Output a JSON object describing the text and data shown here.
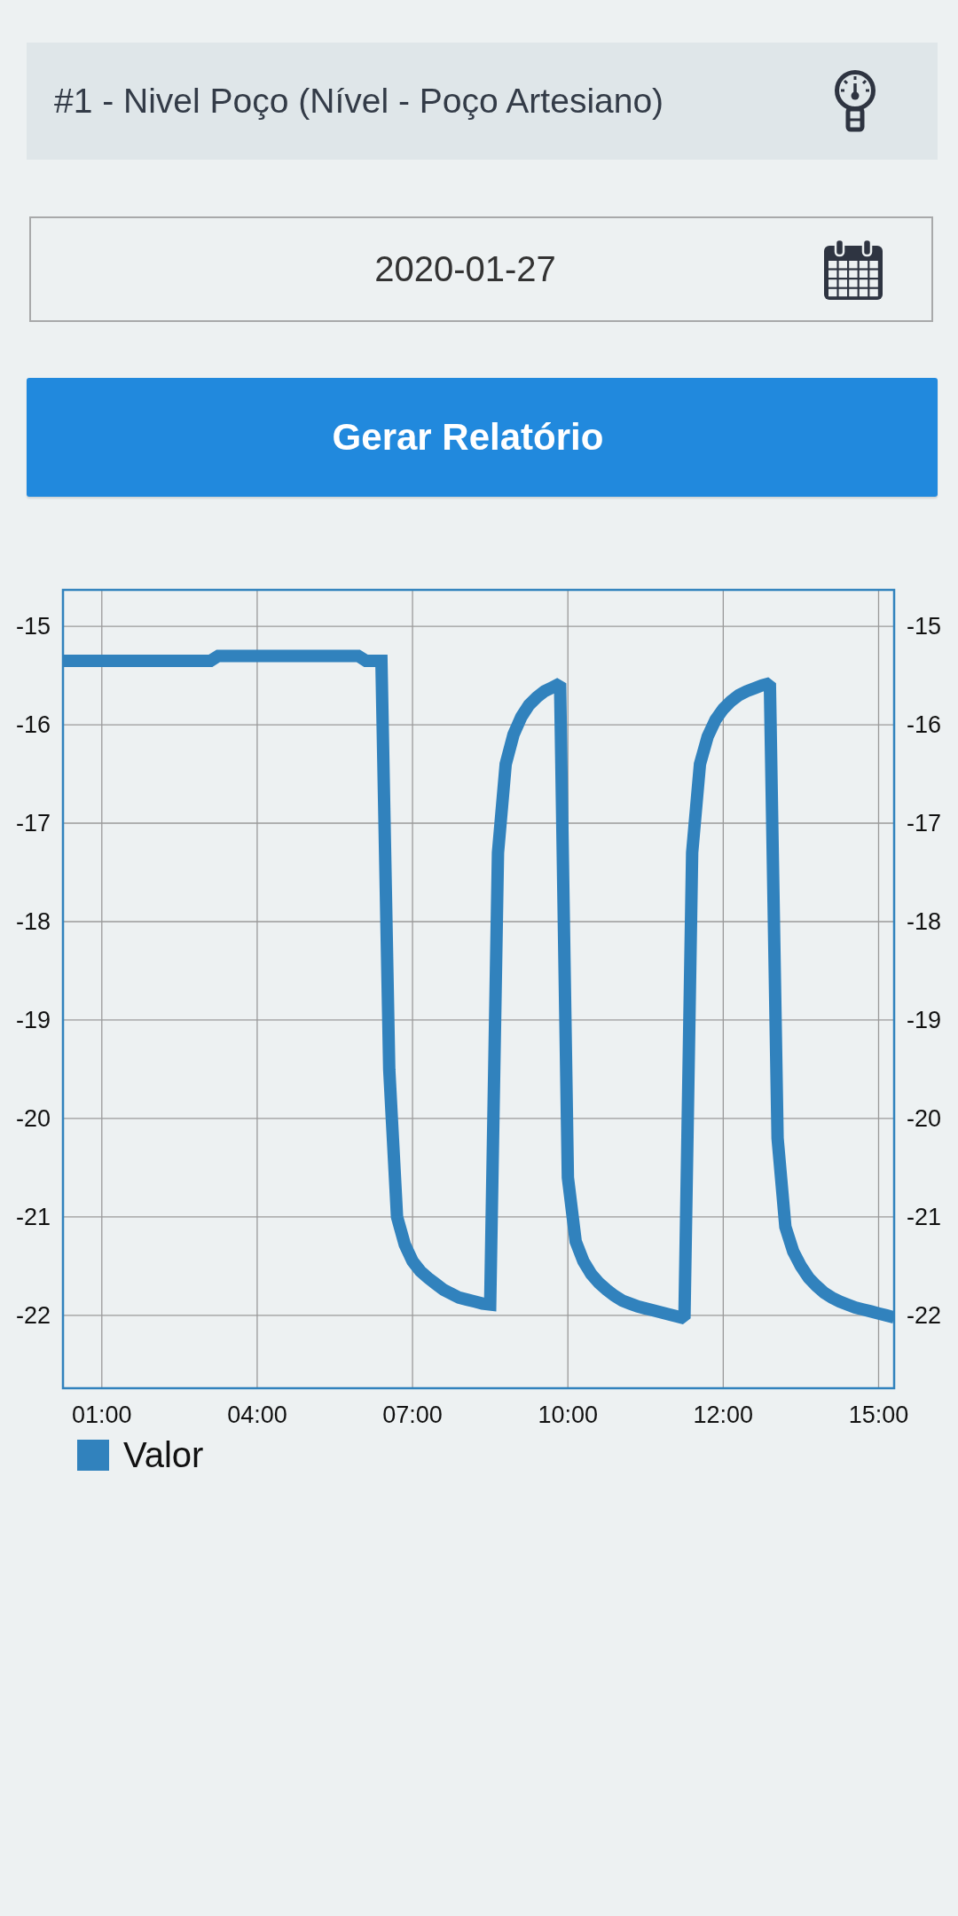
{
  "selector": {
    "label": "#1 - Nivel Poço (Nível - Poço Artesiano)"
  },
  "date_field": {
    "value": "2020-01-27"
  },
  "button": {
    "label": "Gerar Relatório"
  },
  "chart": {
    "chart_data": {
      "type": "line",
      "grid": true,
      "categories": [
        null,
        null,
        null,
        null,
        null,
        "01:00",
        null,
        null,
        null,
        null,
        null,
        null,
        null,
        null,
        null,
        null,
        null,
        null,
        null,
        null,
        null,
        null,
        null,
        null,
        null,
        "04:00",
        null,
        null,
        null,
        null,
        null,
        null,
        null,
        null,
        null,
        null,
        null,
        null,
        null,
        null,
        null,
        null,
        null,
        null,
        null,
        "07:00",
        null,
        null,
        null,
        null,
        null,
        null,
        null,
        null,
        null,
        null,
        null,
        null,
        null,
        null,
        null,
        null,
        null,
        null,
        null,
        "10:00",
        null,
        null,
        null,
        null,
        null,
        null,
        null,
        null,
        null,
        null,
        null,
        null,
        null,
        null,
        null,
        null,
        null,
        null,
        null,
        "12:00",
        null,
        null,
        null,
        null,
        null,
        null,
        null,
        null,
        null,
        null,
        null,
        null,
        null,
        null,
        null,
        null,
        null,
        null,
        null,
        "15:00",
        null,
        null
      ],
      "series": [
        {
          "name": "Valor",
          "color": "#3182bd",
          "values": [
            -15.35,
            -15.35,
            -15.35,
            -15.35,
            -15.35,
            -15.35,
            -15.35,
            -15.35,
            -15.35,
            -15.35,
            -15.35,
            -15.35,
            -15.35,
            -15.35,
            -15.35,
            -15.35,
            -15.35,
            -15.35,
            -15.35,
            -15.35,
            -15.3,
            -15.3,
            -15.3,
            -15.3,
            -15.3,
            -15.3,
            -15.3,
            -15.3,
            -15.3,
            -15.3,
            -15.3,
            -15.3,
            -15.3,
            -15.3,
            -15.3,
            -15.3,
            -15.3,
            -15.3,
            -15.3,
            -15.35,
            -15.35,
            -15.35,
            -19.5,
            -21.0,
            -21.28,
            -21.45,
            -21.55,
            -21.62,
            -21.68,
            -21.74,
            -21.78,
            -21.82,
            -21.84,
            -21.86,
            -21.88,
            -21.89,
            -17.3,
            -16.4,
            -16.1,
            -15.92,
            -15.8,
            -15.72,
            -15.66,
            -15.62,
            -15.58,
            -20.6,
            -21.25,
            -21.45,
            -21.58,
            -21.67,
            -21.74,
            -21.8,
            -21.85,
            -21.88,
            -21.91,
            -21.93,
            -21.95,
            -21.97,
            -21.99,
            -22.01,
            -22.03,
            -17.3,
            -16.4,
            -16.12,
            -15.95,
            -15.84,
            -15.76,
            -15.7,
            -15.66,
            -15.63,
            -15.6,
            -15.58,
            -20.2,
            -21.1,
            -21.35,
            -21.5,
            -21.62,
            -21.7,
            -21.77,
            -21.82,
            -21.86,
            -21.89,
            -21.92,
            -21.94,
            -21.96,
            -21.98,
            -22.0,
            -22.02
          ]
        }
      ],
      "ylim": [
        -22.74,
        -14.63
      ],
      "yticks": [
        {
          "value": -15,
          "label": "-15"
        },
        {
          "value": -16,
          "label": "-16"
        },
        {
          "value": -17,
          "label": "-17"
        },
        {
          "value": -18,
          "label": "-18"
        },
        {
          "value": -19,
          "label": "-19"
        },
        {
          "value": -20,
          "label": "-20"
        },
        {
          "value": -21,
          "label": "-21"
        },
        {
          "value": -22,
          "label": "-22"
        }
      ]
    },
    "right_axis_labels": [
      "-15",
      "-16",
      "-17",
      "-18",
      "-19",
      "-20",
      "-21",
      "-22"
    ]
  }
}
